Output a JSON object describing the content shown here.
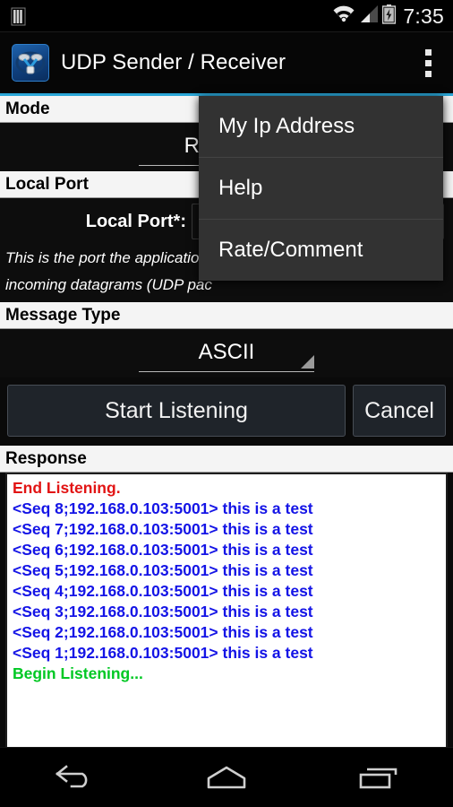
{
  "statusbar": {
    "sim_icon": "sim-bars-icon",
    "wifi_icon": "wifi-icon",
    "signal_icon": "cellular-signal-icon",
    "battery_icon": "battery-charging-icon",
    "clock": "7:35"
  },
  "actionbar": {
    "app_icon": "udp-app-icon",
    "title": "UDP Sender / Receiver",
    "overflow_icon": "overflow-menu-icon"
  },
  "sections": {
    "mode_header": "Mode",
    "mode_value": "Receiver",
    "local_port_header": "Local Port",
    "local_port_label": "Local Port*:",
    "local_port_value": "",
    "hint_line1": "This is the port the application",
    "hint_line2": "incoming datagrams (UDP pac",
    "message_type_header": "Message Type",
    "message_type_value": "ASCII",
    "response_header": "Response"
  },
  "buttons": {
    "primary": "Start Listening",
    "secondary": "Cancel"
  },
  "menu": {
    "items": [
      {
        "label": "My Ip Address"
      },
      {
        "label": "Help"
      },
      {
        "label": "Rate/Comment"
      }
    ]
  },
  "log": {
    "lines": [
      {
        "text": "End Listening.",
        "kind": "end"
      },
      {
        "text": "<Seq 8;192.168.0.103:5001> this is a test",
        "kind": "msg"
      },
      {
        "text": "<Seq 7;192.168.0.103:5001> this is a test",
        "kind": "msg"
      },
      {
        "text": "<Seq 6;192.168.0.103:5001> this is a test",
        "kind": "msg"
      },
      {
        "text": "<Seq 5;192.168.0.103:5001> this is a test",
        "kind": "msg"
      },
      {
        "text": "<Seq 4;192.168.0.103:5001> this is a test",
        "kind": "msg"
      },
      {
        "text": "<Seq 3;192.168.0.103:5001> this is a test",
        "kind": "msg"
      },
      {
        "text": "<Seq 2;192.168.0.103:5001> this is a test",
        "kind": "msg"
      },
      {
        "text": "<Seq 1;192.168.0.103:5001> this is a test",
        "kind": "msg"
      },
      {
        "text": "Begin Listening...",
        "kind": "begin"
      }
    ]
  },
  "navbar": {
    "back": "back-icon",
    "home": "home-icon",
    "recents": "recent-apps-icon"
  },
  "colors": {
    "accent": "#2aa7d8",
    "log_error": "#e21414",
    "log_message": "#1414e6",
    "log_success": "#00c824"
  }
}
